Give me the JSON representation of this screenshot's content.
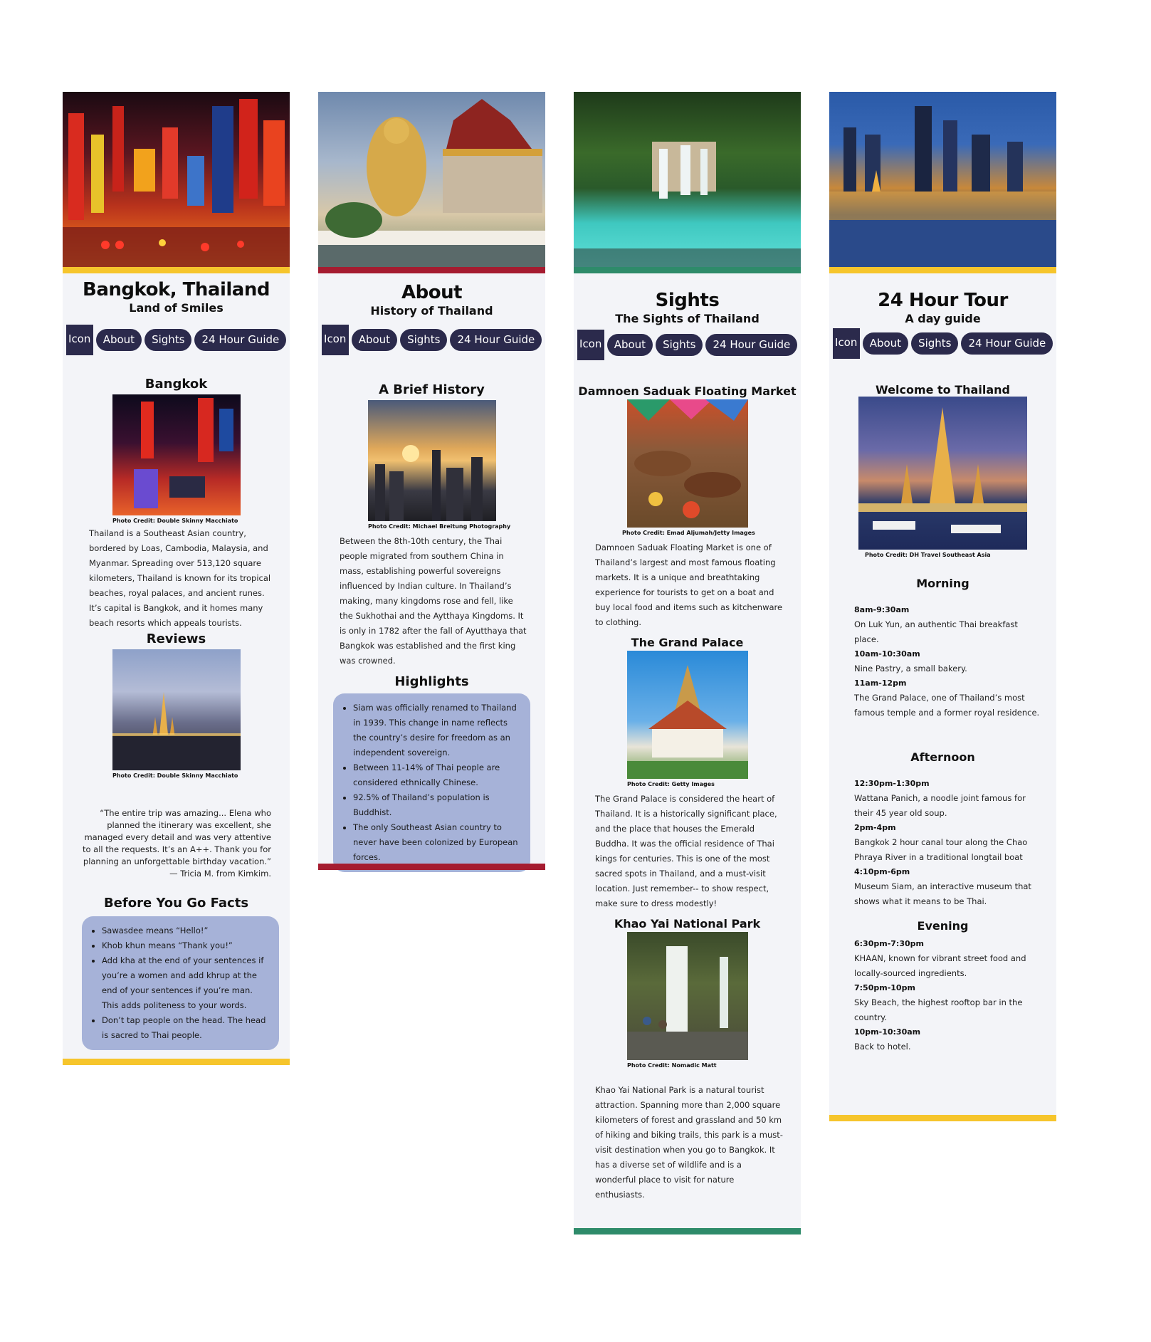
{
  "cards": {
    "bangkok": {
      "title": "Bangkok, Thailand",
      "subtitle": "Land of Smiles",
      "accent": "#f6c52c",
      "nav": {
        "icon": "Icon",
        "about": "About",
        "sights": "Sights",
        "guide": "24 Hour Guide"
      },
      "section1": "Bangkok",
      "credit1": "Photo Credit: Double Skinny Macchiato",
      "para1": "Thailand is a Southeast Asian country, bordered by Loas, Cambodia, Malaysia, and Myanmar. Spreading over 513,120 square kilometers, Thailand is known for its tropical beaches, royal palaces, and ancient runes. It’s capital is Bangkok, and it homes many beach resorts which appeals tourists.",
      "section2": "Reviews",
      "credit2": "Photo Credit: Double Skinny Macchiato",
      "review": "“The entire trip was amazing...  Elena who planned the itinerary was  excellent, she managed every detail and was very attentive to all the  requests. It’s an A++. Thank you for planning an unforgettable birthday  vacation.”",
      "review_author": "— Tricia M. from Kimkim.",
      "section3": "Before You Go Facts",
      "facts": [
        "Sawasdee means “Hello!”",
        "Khob khun means “Thank you!”",
        "Add kha at the end of your sentences if you’re a women and add khrup at the end of your sentences if you’re man. This adds politeness to your words.",
        "Don’t tap people on the head. The head is sacred to Thai people."
      ]
    },
    "about": {
      "title": "About",
      "subtitle": "History of Thailand",
      "accent": "#a51c30",
      "nav": {
        "icon": "Icon",
        "about": "About",
        "sights": "Sights",
        "guide": "24 Hour Guide"
      },
      "section1": "A Brief History",
      "credit1": "Photo Credit: Michael Breitung Photography",
      "para1": "Between the 8th-10th century, the Thai people migrated from southern China in mass, establishing powerful sovereigns influenced by Indian culture. In Thailand’s making, many kingdoms rose and fell, like the Sukhothai and the Aytthaya Kingdoms. It is only in 1782 after the fall of Ayutthaya that Bangkok was established and the first king was crowned.",
      "section2": "Highlights",
      "highlights": [
        "Siam was officially renamed to Thailand in 1939. This change in name reflects the country’s desire for freedom as an independent sovereign.",
        "Between 11-14% of Thai people are considered ethnically Chinese.",
        "92.5% of Thailand’s population is Buddhist.",
        "The only Southeast Asian country to never have been colonized by European forces."
      ]
    },
    "sights": {
      "title": "Sights",
      "subtitle": "The Sights of Thailand",
      "accent": "#2e8b6a",
      "nav": {
        "icon": "Icon",
        "about": "About",
        "sights": "Sights",
        "guide": "24 Hour Guide"
      },
      "section1": "Damnoen  Saduak Floating Market",
      "credit1": "Photo Credit: Emad Aljumah/Jetty Images",
      "para1": "Damnoen Saduak Floating Market is one of Thailand’s largest and most famous floating markets. It is a unique and breathtaking experience for tourists to get on a boat and buy local food and items such as kitchenware to clothing.",
      "section2": "The Grand Palace",
      "credit2": "Photo Credit: Getty Images",
      "para2": "The Grand Palace is considered the heart of Thailand. It is a historically significant place, and the place that houses the Emerald Buddha. It was the official residence of Thai kings for centuries. This is one of the most sacred spots in Thailand, and a must-visit location. Just remember-- to show respect, make sure to dress modestly!",
      "section3": "Khao Yai National Park",
      "credit3": "Photo Credit: Nomadic Matt",
      "para3": "Khao Yai National Park is a natural tourist attraction. Spanning more than 2,000 square kilometers of forest and grassland and 50 km of hiking and biking trails, this park is a must-visit destination when you go to Bangkok. It has a diverse set of wildlife and is a wonderful place to visit for nature enthusiasts."
    },
    "tour": {
      "title": "24 Hour Tour",
      "subtitle": "A day guide",
      "accent": "#f6c52c",
      "nav": {
        "icon": "Icon",
        "about": "About",
        "sights": "Sights",
        "guide": "24 Hour Guide"
      },
      "section1": "Welcome to Thailand",
      "credit1": "Photo Credit: DH Travel Southeast Asia",
      "morning": {
        "heading": "Morning",
        "items": [
          {
            "time": "8am-9:30am",
            "desc": "On Luk Yun, an authentic Thai breakfast place."
          },
          {
            "time": "10am-10:30am",
            "desc": "Nine Pastry, a small bakery."
          },
          {
            "time": "11am-12pm",
            "desc": "The Grand Palace, one of Thailand’s most famous temple and a former royal residence."
          }
        ]
      },
      "afternoon": {
        "heading": "Afternoon",
        "items": [
          {
            "time": "12:30pm-1:30pm",
            "desc": "Wattana Panich, a noodle joint famous for their 45 year old soup."
          },
          {
            "time": "2pm-4pm",
            "desc": "Bangkok 2 hour canal tour along the Chao Phraya River in a traditional longtail boat"
          },
          {
            "time": "4:10pm-6pm",
            "desc": "Museum Siam, an interactive museum that shows what it means to be Thai."
          }
        ]
      },
      "evening": {
        "heading": "Evening",
        "items": [
          {
            "time": "6:30pm-7:30pm",
            "desc": "KHAAN, known for vibrant street food and locally-sourced ingredients."
          },
          {
            "time": "7:50pm-10pm",
            "desc": "Sky Beach, the highest rooftop bar in the country."
          },
          {
            "time": "10pm-10:30am",
            "desc": "Back to hotel."
          }
        ]
      }
    }
  }
}
